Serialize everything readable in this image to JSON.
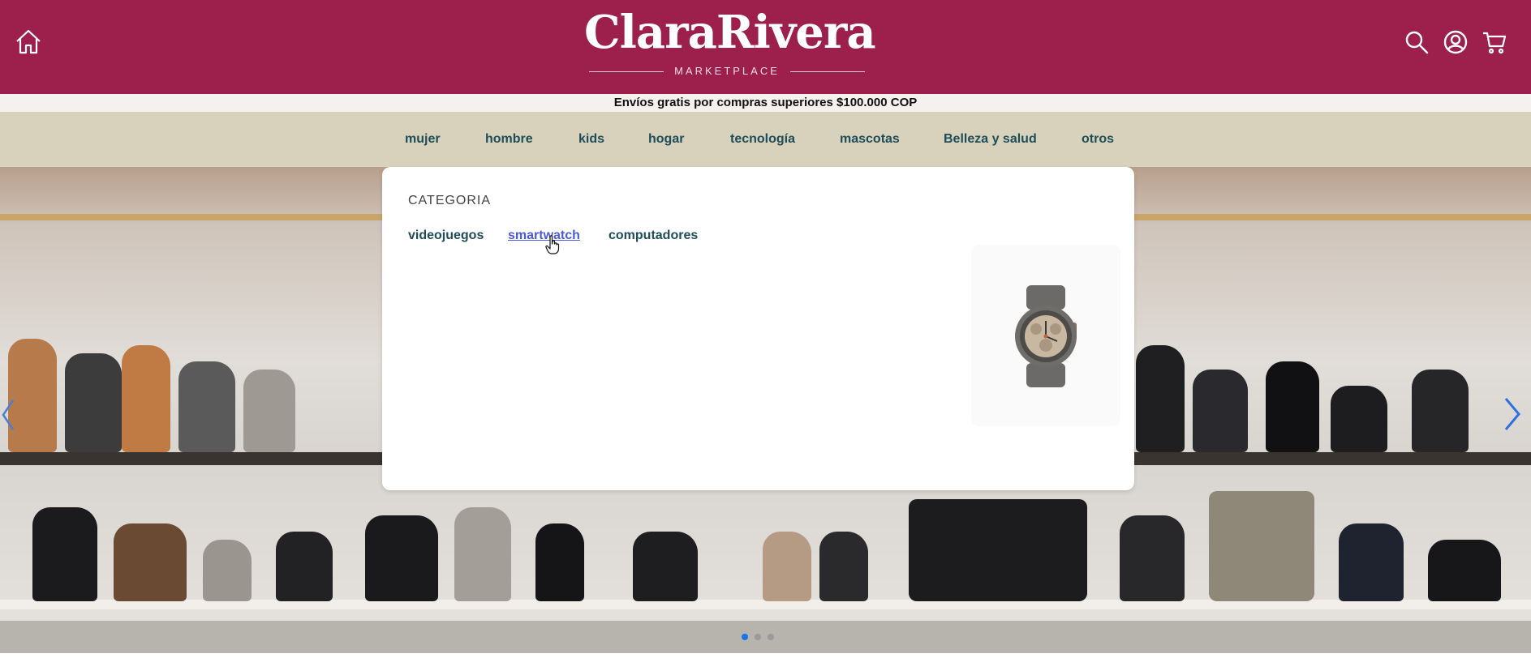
{
  "header": {
    "logo_text": "ClaraRivera",
    "logo_subtitle": "MARKETPLACE",
    "colors": {
      "brand": "#9c204b",
      "icons": "#ffffff"
    },
    "icons": [
      "home-icon",
      "search-icon",
      "account-icon",
      "cart-icon"
    ]
  },
  "promo": {
    "text": "Envíos gratis por compras superiores $100.000 COP"
  },
  "nav": {
    "items": [
      "mujer",
      "hombre",
      "kids",
      "hogar",
      "tecnología",
      "mascotas",
      "Belleza y salud",
      "otros"
    ],
    "color": "#1f4d57"
  },
  "dropdown": {
    "heading": "CATEGORIA",
    "links": [
      "videojuegos",
      "smartwatch",
      "computadores"
    ],
    "active_link": "smartwatch",
    "active_color": "#4a5bd6",
    "image": "smartwatch-image"
  },
  "carousel": {
    "slide_count": 3,
    "active_slide": 1,
    "icons": [
      "chevron-left-icon",
      "chevron-right-icon"
    ]
  }
}
